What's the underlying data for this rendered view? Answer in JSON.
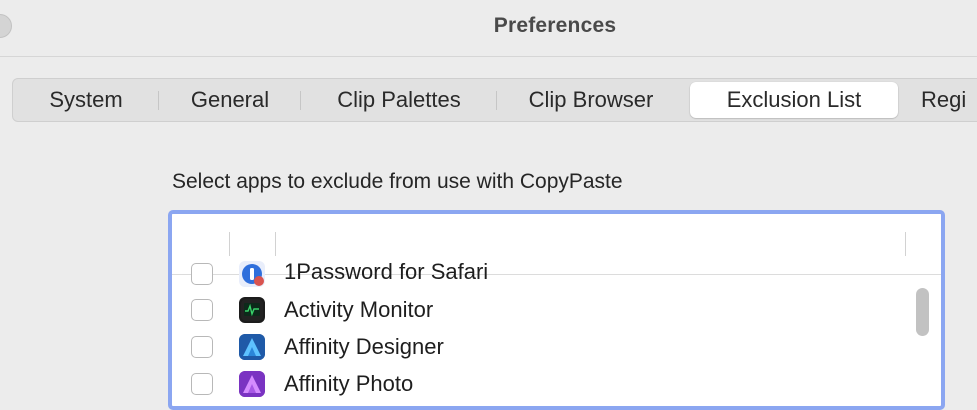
{
  "window": {
    "title": "Preferences"
  },
  "tabs": [
    {
      "label": "System",
      "active": false
    },
    {
      "label": "General",
      "active": false
    },
    {
      "label": "Clip Palettes",
      "active": false
    },
    {
      "label": "Clip Browser",
      "active": false
    },
    {
      "label": "Exclusion List",
      "active": true
    },
    {
      "label": "Regi",
      "active": false
    }
  ],
  "exclusion": {
    "instructions": "Select apps to exclude from use with CopyPaste",
    "apps": [
      {
        "name": "1Password for Safari",
        "checked": false,
        "icon": "1password-icon"
      },
      {
        "name": "Activity Monitor",
        "checked": false,
        "icon": "activity-monitor-icon"
      },
      {
        "name": "Affinity Designer",
        "checked": false,
        "icon": "affinity-designer-icon"
      },
      {
        "name": "Affinity Photo",
        "checked": false,
        "icon": "affinity-photo-icon"
      }
    ]
  },
  "colors": {
    "focus_ring": "#8ba6f1",
    "window_bg": "#ececec",
    "tab_bar_bg": "#e1e1e1",
    "active_tab_bg": "#ffffff"
  }
}
